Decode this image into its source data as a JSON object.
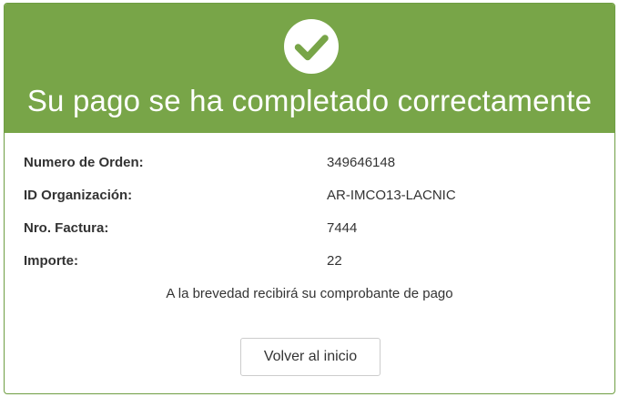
{
  "header": {
    "icon": "check-circle-icon",
    "title": "Su pago se ha completado correctamente",
    "color": "#78a548"
  },
  "details": [
    {
      "label": "Numero de Orden:",
      "value": "349646148"
    },
    {
      "label": "ID Organización:",
      "value": "AR-IMCO13-LACNIC"
    },
    {
      "label": "Nro. Factura:",
      "value": "7444"
    },
    {
      "label": "Importe:",
      "value": "22"
    }
  ],
  "notice": "A la brevedad recibirá su comprobante de pago",
  "back_button": {
    "label": "Volver al inicio"
  }
}
